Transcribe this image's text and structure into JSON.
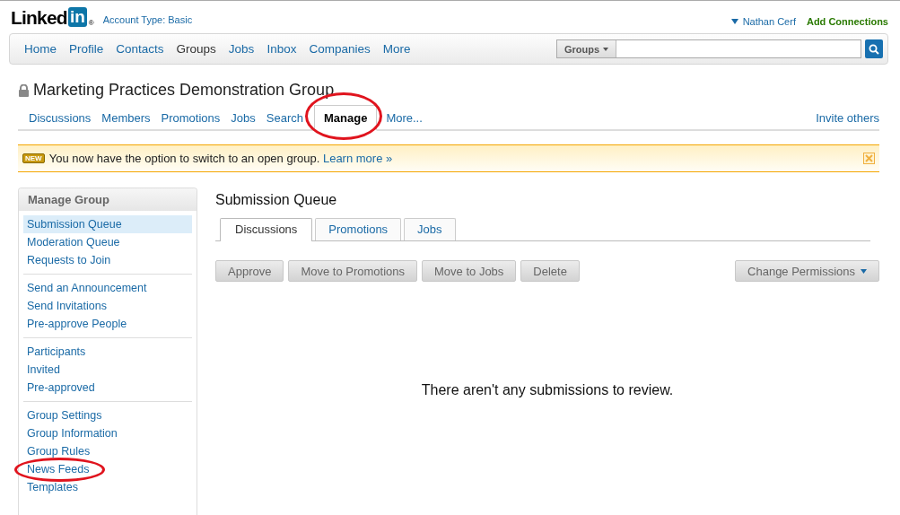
{
  "header": {
    "logo_text": "Linked",
    "logo_badge": "in",
    "logo_mark": "®",
    "account_type": "Account Type: Basic",
    "user_menu": "Nathan Cerf",
    "add_connections": "Add Connections"
  },
  "nav": {
    "items": [
      {
        "label": "Home",
        "selected": false
      },
      {
        "label": "Profile",
        "selected": false
      },
      {
        "label": "Contacts",
        "selected": false
      },
      {
        "label": "Groups",
        "selected": true
      },
      {
        "label": "Jobs",
        "selected": false
      },
      {
        "label": "Inbox",
        "selected": false
      },
      {
        "label": "Companies",
        "selected": false
      },
      {
        "label": "More",
        "selected": false
      }
    ],
    "search_scope": "Groups"
  },
  "group": {
    "title": "Marketing Practices Demonstration Group",
    "tabs": [
      {
        "label": "Discussions",
        "selected": false,
        "circled": false
      },
      {
        "label": "Members",
        "selected": false,
        "circled": false
      },
      {
        "label": "Promotions",
        "selected": false,
        "circled": false
      },
      {
        "label": "Jobs",
        "selected": false,
        "circled": false
      },
      {
        "label": "Search",
        "selected": false,
        "circled": false
      },
      {
        "label": "Manage",
        "selected": true,
        "circled": true
      },
      {
        "label": "More...",
        "selected": false,
        "circled": false
      }
    ],
    "invite": "Invite others"
  },
  "notice": {
    "badge": "NEW",
    "text": "You now have the option to switch to an open group.",
    "link": "Learn more »"
  },
  "sidebar": {
    "title": "Manage Group",
    "sections": [
      {
        "items": [
          {
            "label": "Submission Queue",
            "selected": true,
            "circled": false
          },
          {
            "label": "Moderation Queue",
            "selected": false,
            "circled": false
          },
          {
            "label": "Requests to Join",
            "selected": false,
            "circled": false
          }
        ]
      },
      {
        "items": [
          {
            "label": "Send an Announcement",
            "selected": false,
            "circled": false
          },
          {
            "label": "Send Invitations",
            "selected": false,
            "circled": false
          },
          {
            "label": "Pre-approve People",
            "selected": false,
            "circled": false
          }
        ]
      },
      {
        "items": [
          {
            "label": "Participants",
            "selected": false,
            "circled": false
          },
          {
            "label": "Invited",
            "selected": false,
            "circled": false
          },
          {
            "label": "Pre-approved",
            "selected": false,
            "circled": false
          }
        ]
      },
      {
        "items": [
          {
            "label": "Group Settings",
            "selected": false,
            "circled": false
          },
          {
            "label": "Group Information",
            "selected": false,
            "circled": false
          },
          {
            "label": "Group Rules",
            "selected": false,
            "circled": false
          },
          {
            "label": "News Feeds",
            "selected": false,
            "circled": true
          },
          {
            "label": "Templates",
            "selected": false,
            "circled": false
          }
        ]
      }
    ]
  },
  "main": {
    "title": "Submission Queue",
    "tabs": [
      {
        "label": "Discussions",
        "selected": true
      },
      {
        "label": "Promotions",
        "selected": false
      },
      {
        "label": "Jobs",
        "selected": false
      }
    ],
    "actions": [
      "Approve",
      "Move to Promotions",
      "Move to Jobs",
      "Delete"
    ],
    "permissions": "Change Permissions",
    "empty_message": "There aren't any submissions to review."
  }
}
